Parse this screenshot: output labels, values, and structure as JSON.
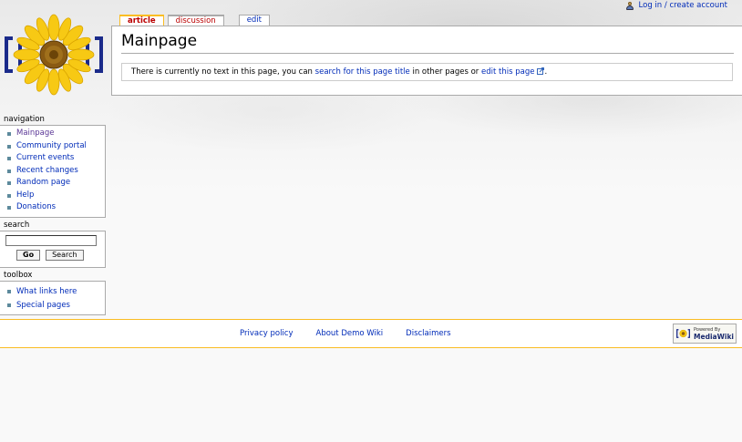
{
  "personal": {
    "login": "Log in / create account"
  },
  "tabs": {
    "article": "article",
    "discussion": "discussion",
    "edit": "edit"
  },
  "content": {
    "title": "Mainpage",
    "notice": {
      "before": "There is currently no text in this page, you can ",
      "search_link": "search for this page title",
      "middle": " in other pages or ",
      "edit_link": "edit this page",
      "after": "."
    }
  },
  "navigation": {
    "heading": "navigation",
    "items": [
      {
        "label": "Mainpage"
      },
      {
        "label": "Community portal"
      },
      {
        "label": "Current events"
      },
      {
        "label": "Recent changes"
      },
      {
        "label": "Random page"
      },
      {
        "label": "Help"
      },
      {
        "label": "Donations"
      }
    ]
  },
  "search": {
    "heading": "search",
    "value": "",
    "go_label": "Go",
    "search_label": "Search"
  },
  "toolbox": {
    "heading": "toolbox",
    "items": [
      {
        "label": "What links here"
      },
      {
        "label": "Special pages"
      }
    ]
  },
  "footer": {
    "links": [
      {
        "label": "Privacy policy"
      },
      {
        "label": "About Demo Wiki"
      },
      {
        "label": "Disclaimers"
      }
    ],
    "powered_small": "Powered By",
    "powered_big": "MediaWiki"
  },
  "colors": {
    "link": "#002bb8",
    "visited": "#5a3696",
    "new_link": "#ba0000",
    "tab_accent": "#fabd23",
    "border": "#aaaaaa"
  }
}
